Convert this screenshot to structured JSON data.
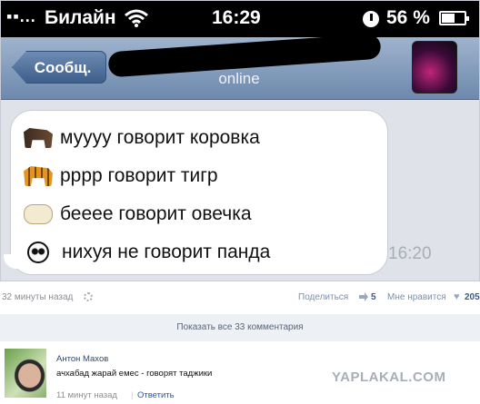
{
  "status_bar": {
    "signal": "▪▪...",
    "carrier": "Билайн",
    "time": "16:29",
    "battery_percent": "56 %",
    "battery_level": 0.56
  },
  "nav": {
    "back_label": "Сообщ.",
    "status": "online"
  },
  "message": {
    "lines": [
      {
        "icon": "cow-emoji-icon",
        "text": "муууу говорит коровка"
      },
      {
        "icon": "tiger-emoji-icon",
        "text": "рррр говорит тигр"
      },
      {
        "icon": "sheep-emoji-icon",
        "text": "бееее говорит овечка"
      },
      {
        "icon": "panda-emoji-icon",
        "text": "нихуя не говорит панда"
      }
    ],
    "time": "16:20"
  },
  "post_meta": {
    "ago": "32 минуты назад",
    "share_label": "Поделиться",
    "share_count": "5",
    "likes_label": "Мне нравится",
    "likes_count": "205"
  },
  "comments": {
    "show_all_label": "Показать все 33 комментария",
    "items": [
      {
        "author": "Антон Махов",
        "text": "ачхабад жарай емес - говорят таджики",
        "time": "11 минут назад",
        "reply_label": "Ответить"
      }
    ]
  },
  "watermark": "YAPLAKAL.COM"
}
